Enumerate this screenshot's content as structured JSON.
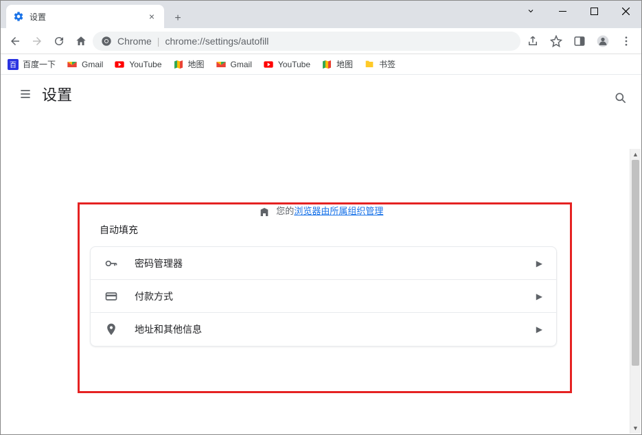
{
  "window": {
    "tab_title": "设置"
  },
  "addressbar": {
    "scheme_label": "Chrome",
    "url_path": "chrome://settings/autofill"
  },
  "bookmarks": [
    {
      "label": "百度一下",
      "icon": "baidu"
    },
    {
      "label": "Gmail",
      "icon": "gmail"
    },
    {
      "label": "YouTube",
      "icon": "youtube"
    },
    {
      "label": "地图",
      "icon": "maps"
    },
    {
      "label": "Gmail",
      "icon": "gmail"
    },
    {
      "label": "YouTube",
      "icon": "youtube"
    },
    {
      "label": "地图",
      "icon": "maps"
    },
    {
      "label": "书签",
      "icon": "folder"
    }
  ],
  "page": {
    "title": "设置",
    "managed_prefix": "您的",
    "managed_link": "浏览器由所属组织管理",
    "section_title": "自动填充",
    "rows": [
      {
        "label": "密码管理器",
        "icon": "key"
      },
      {
        "label": "付款方式",
        "icon": "card"
      },
      {
        "label": "地址和其他信息",
        "icon": "pin"
      }
    ]
  }
}
